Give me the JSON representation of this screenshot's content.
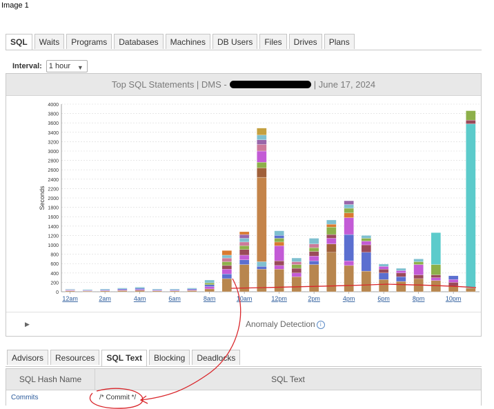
{
  "caption": "Image 1",
  "top_tabs": [
    "SQL",
    "Waits",
    "Programs",
    "Databases",
    "Machines",
    "DB Users",
    "Files",
    "Drives",
    "Plans"
  ],
  "active_top_tab": "SQL",
  "interval": {
    "label": "Interval:",
    "value": "1 hour"
  },
  "chart_header": {
    "left": "Top SQL Statements  |  DMS -",
    "right": "|  June 17, 2024"
  },
  "chart_data": {
    "type": "bar",
    "stacked": true,
    "ylabel": "Seconds",
    "ylim": [
      0,
      4000
    ],
    "ytick_step": 200,
    "grid": true,
    "x_tick_labels": [
      "12am",
      "2am",
      "4am",
      "6am",
      "8am",
      "10am",
      "12pm",
      "2pm",
      "4pm",
      "6pm",
      "8pm",
      "10pm"
    ],
    "hours": [
      "12am",
      "1am",
      "2am",
      "3am",
      "4am",
      "5am",
      "6am",
      "7am",
      "8am",
      "9am",
      "10am",
      "11am",
      "12pm",
      "1pm",
      "2pm",
      "3pm",
      "4pm",
      "5pm",
      "6pm",
      "7pm",
      "8pm",
      "9pm",
      "10pm",
      "11pm"
    ],
    "totals": [
      60,
      50,
      60,
      80,
      100,
      60,
      60,
      80,
      250,
      880,
      1280,
      3490,
      1300,
      720,
      1140,
      1530,
      1940,
      1200,
      590,
      500,
      700,
      1260,
      340,
      3860
    ],
    "segments": [
      [
        [
          "#b8864e",
          20
        ],
        [
          "#c35bd6",
          10
        ],
        [
          "#9966aa",
          10
        ],
        [
          "#5b6fd0",
          10
        ],
        [
          "#7fc0d0",
          10
        ]
      ],
      [
        [
          "#b8864e",
          15
        ],
        [
          "#c35bd6",
          10
        ],
        [
          "#5b6fd0",
          10
        ],
        [
          "#7fc0d0",
          15
        ]
      ],
      [
        [
          "#b8864e",
          20
        ],
        [
          "#c35bd6",
          10
        ],
        [
          "#5b6fd0",
          15
        ],
        [
          "#7fc0d0",
          15
        ]
      ],
      [
        [
          "#b8864e",
          25
        ],
        [
          "#c35bd6",
          15
        ],
        [
          "#5b6fd0",
          20
        ],
        [
          "#7fc0d0",
          20
        ]
      ],
      [
        [
          "#b8864e",
          30
        ],
        [
          "#c35bd6",
          20
        ],
        [
          "#5b6fd0",
          25
        ],
        [
          "#7fc0d0",
          25
        ]
      ],
      [
        [
          "#b8864e",
          20
        ],
        [
          "#c35bd6",
          10
        ],
        [
          "#5b6fd0",
          15
        ],
        [
          "#7fc0d0",
          15
        ]
      ],
      [
        [
          "#b8864e",
          20
        ],
        [
          "#c35bd6",
          10
        ],
        [
          "#5b6fd0",
          15
        ],
        [
          "#7fc0d0",
          15
        ]
      ],
      [
        [
          "#b8864e",
          25
        ],
        [
          "#c35bd6",
          15
        ],
        [
          "#5b6fd0",
          20
        ],
        [
          "#7fc0d0",
          20
        ]
      ],
      [
        [
          "#b8864e",
          60
        ],
        [
          "#c35bd6",
          50
        ],
        [
          "#5b6fd0",
          40
        ],
        [
          "#8db04a",
          40
        ],
        [
          "#7fc0d0",
          60
        ]
      ],
      [
        [
          "#b8864e",
          280
        ],
        [
          "#5b6fd0",
          100
        ],
        [
          "#c35bd6",
          100
        ],
        [
          "#9a4a5a",
          80
        ],
        [
          "#8db04a",
          80
        ],
        [
          "#cc7a9a",
          80
        ],
        [
          "#7fc0d0",
          60
        ],
        [
          "#d97a30",
          100
        ]
      ],
      [
        [
          "#b8864e",
          580
        ],
        [
          "#5b6fd0",
          100
        ],
        [
          "#c35bd6",
          100
        ],
        [
          "#9a4a5a",
          120
        ],
        [
          "#8db04a",
          80
        ],
        [
          "#cc7a9a",
          80
        ],
        [
          "#7fc0d0",
          80
        ],
        [
          "#9966aa",
          80
        ],
        [
          "#d97a30",
          60
        ]
      ],
      [
        [
          "#b8864e",
          480
        ],
        [
          "#5b6fd0",
          60
        ],
        [
          "#7fc0d0",
          100
        ],
        [
          "#c4844a",
          1800
        ],
        [
          "#a0603a",
          200
        ],
        [
          "#8db04a",
          120
        ],
        [
          "#c35bd6",
          240
        ],
        [
          "#cc7a9a",
          140
        ],
        [
          "#9966aa",
          100
        ],
        [
          "#7fc0d0",
          100
        ],
        [
          "#c4a040",
          150
        ]
      ],
      [
        [
          "#b8864e",
          480
        ],
        [
          "#c35bd6",
          80
        ],
        [
          "#9a4a5a",
          100
        ],
        [
          "#c35bd6",
          320
        ],
        [
          "#d97a30",
          80
        ],
        [
          "#8db04a",
          80
        ],
        [
          "#5b6fd0",
          60
        ],
        [
          "#7fc0d0",
          100
        ]
      ],
      [
        [
          "#b8864e",
          320
        ],
        [
          "#c35bd6",
          80
        ],
        [
          "#9a4a5a",
          100
        ],
        [
          "#8db04a",
          80
        ],
        [
          "#cc7a9a",
          60
        ],
        [
          "#7fc0d0",
          80
        ]
      ],
      [
        [
          "#b8864e",
          580
        ],
        [
          "#5b6fd0",
          80
        ],
        [
          "#c35bd6",
          100
        ],
        [
          "#9a4a5a",
          100
        ],
        [
          "#8db04a",
          80
        ],
        [
          "#cc7a9a",
          80
        ],
        [
          "#7fc0d0",
          120
        ]
      ],
      [
        [
          "#b8864e",
          840
        ],
        [
          "#a0603a",
          180
        ],
        [
          "#c35bd6",
          120
        ],
        [
          "#9a4a5a",
          80
        ],
        [
          "#8db04a",
          160
        ],
        [
          "#d97a30",
          60
        ],
        [
          "#7fc0d0",
          90
        ]
      ],
      [
        [
          "#b8864e",
          560
        ],
        [
          "#c35bd6",
          100
        ],
        [
          "#5b6fd0",
          560
        ],
        [
          "#c35bd6",
          360
        ],
        [
          "#d97a30",
          100
        ],
        [
          "#8db04a",
          100
        ],
        [
          "#7fc0d0",
          80
        ],
        [
          "#9966aa",
          80
        ]
      ],
      [
        [
          "#b8864e",
          440
        ],
        [
          "#5b6fd0",
          400
        ],
        [
          "#9a4a5a",
          160
        ],
        [
          "#c35bd6",
          80
        ],
        [
          "#8db04a",
          60
        ],
        [
          "#7fc0d0",
          60
        ]
      ],
      [
        [
          "#b8864e",
          260
        ],
        [
          "#5b6fd0",
          140
        ],
        [
          "#9a4a5a",
          80
        ],
        [
          "#c35bd6",
          60
        ],
        [
          "#7fc0d0",
          50
        ]
      ],
      [
        [
          "#b8864e",
          220
        ],
        [
          "#5b6fd0",
          100
        ],
        [
          "#9a4a5a",
          80
        ],
        [
          "#c35bd6",
          50
        ],
        [
          "#7fc0d0",
          50
        ]
      ],
      [
        [
          "#b8864e",
          280
        ],
        [
          "#9a4a5a",
          80
        ],
        [
          "#c35bd6",
          220
        ],
        [
          "#8db04a",
          60
        ],
        [
          "#7fc0d0",
          60
        ]
      ],
      [
        [
          "#b8864e",
          240
        ],
        [
          "#c35bd6",
          60
        ],
        [
          "#9a4a5a",
          60
        ],
        [
          "#8db04a",
          220
        ],
        [
          "#5ccbcb",
          680
        ]
      ],
      [
        [
          "#b8864e",
          120
        ],
        [
          "#9a4a5a",
          80
        ],
        [
          "#c35bd6",
          60
        ],
        [
          "#5b6fd0",
          80
        ]
      ],
      [
        [
          "#b8864e",
          80
        ],
        [
          "#5ccbcb",
          3500
        ],
        [
          "#9a4a5a",
          80
        ],
        [
          "#8db04a",
          200
        ]
      ]
    ]
  },
  "anomaly": {
    "label": "Anomaly Detection"
  },
  "bottom_tabs": [
    "Advisors",
    "Resources",
    "SQL Text",
    "Blocking",
    "Deadlocks"
  ],
  "active_bottom_tab": "SQL Text",
  "grid": {
    "columns": [
      "SQL Hash Name",
      "SQL Text"
    ],
    "rows": [
      {
        "hash": "Commits",
        "text": "/* Commit */"
      }
    ]
  },
  "colors": {
    "annotation": "#d9252a",
    "link": "#2a5a9b",
    "header_bg": "#e8e8e8"
  }
}
